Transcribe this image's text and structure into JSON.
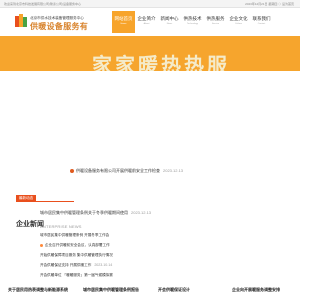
{
  "top_bar": {
    "left_text": "欢迎来到北京市科技发展有限公司(隆泰公司)设备服务中心",
    "right_text": "2023年12月21日 星期四 ◇ 设为首页"
  },
  "logo": {
    "small_text": "北京市供水技术装备管理服务中心",
    "big_text": "供暖设备服务有"
  },
  "nav": [
    {
      "cn": "网站首页",
      "en": "Home"
    },
    {
      "cn": "企业简介",
      "en": "About"
    },
    {
      "cn": "新闻中心",
      "en": "News"
    },
    {
      "cn": "供热技术",
      "en": "Technology"
    },
    {
      "cn": "供热服务",
      "en": "Service"
    },
    {
      "cn": "企业文化",
      "en": "Culture"
    },
    {
      "cn": "联系我们",
      "en": "Contact"
    }
  ],
  "banner": {
    "text": "家家暖热热服",
    "bg_color": "#f6a52d"
  },
  "top_news": [
    {
      "title": "供暖设备服务有限公司开展供暖前安全工作检查",
      "date": "2023.12.13"
    },
    {
      "title": "城市居民集中供暖管理条例关于冬季供暖期间使用",
      "date": "2023.12.13"
    }
  ],
  "label_tag": "最新动态",
  "section": {
    "title": "企业新闻",
    "subtitle": "ENTERPRISE NEWS"
  },
  "news_list": [
    {
      "title": "城市居民集中供暖管理条例 开展冬季工作会",
      "date": "2023.12.22"
    },
    {
      "title": "企业召开供暖前安全会议，认真部署工作",
      "date": "2023.12.04"
    },
    {
      "title": "开始供暖保障项目服务 集中供暖管理执行情况",
      "date": "2023.10.14"
    },
    {
      "title": "开会供暖保证支持 开展供暖工作",
      "date": "2023.10.14"
    },
    {
      "title": "开会供暖单位 「暖暖服务」第一届气候模拟赛",
      "date": ""
    }
  ],
  "cards": [
    "关于居民用热表调整与新能源系统",
    "城市居民集中供暖管理条例报告",
    "开会供暖保证设计",
    "企业向开展暖服务调整安排"
  ],
  "colors": {
    "accent": "#f7a42b",
    "red": "#e94f1d"
  }
}
